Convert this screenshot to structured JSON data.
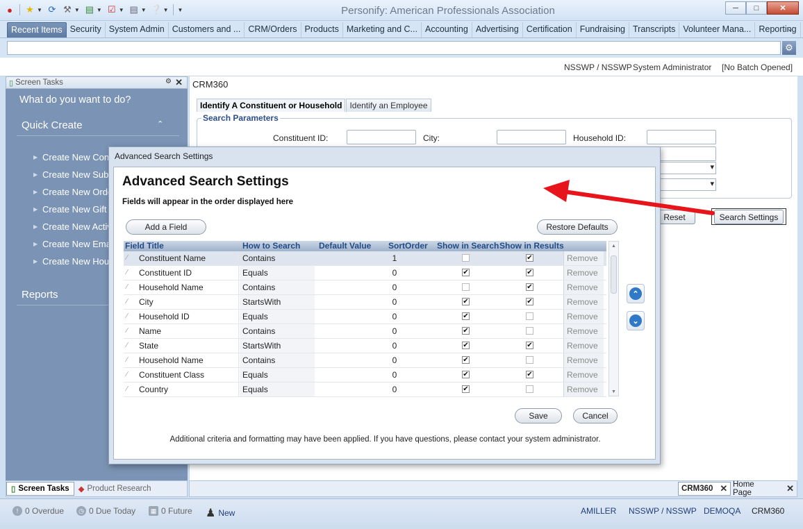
{
  "app": {
    "title": "Personify: American Professionals Association"
  },
  "ribbon": {
    "tabs": [
      "Recent Items",
      "Security",
      "System Admin",
      "Customers and ...",
      "CRM/Orders",
      "Products",
      "Marketing and C...",
      "Accounting",
      "Advertising",
      "Certification",
      "Fundraising",
      "Transcripts",
      "Volunteer Mana...",
      "Reporting"
    ]
  },
  "status": {
    "org": "NSSWP / NSSWP",
    "role": "System Administrator",
    "batch": "[No Batch Opened]"
  },
  "left_pane": {
    "header": "Screen Tasks",
    "question": "What do you want to do?",
    "quick_create": "Quick Create",
    "items": [
      "Create New Cons",
      "Create New Subs",
      "Create New Orde",
      "Create New Gift",
      "Create New Activ",
      "Create New Ema",
      "Create New Hous"
    ],
    "reports": "Reports",
    "bottom_tabs": [
      "Screen Tasks",
      "Product Research"
    ]
  },
  "main": {
    "title": "CRM360",
    "tabs": [
      "Identify A Constituent or Household",
      "Identify an Employee"
    ],
    "search_legend": "Search Parameters",
    "labels": {
      "constituent_id": "Constituent ID:",
      "city": "City:",
      "household_id": "Household ID:"
    },
    "reset": "Reset",
    "search_settings": "Search Settings"
  },
  "modal": {
    "caption": "Advanced Search Settings",
    "heading": "Advanced Search Settings",
    "subheading": "Fields will appear in the order displayed here",
    "add_field": "Add a Field",
    "restore": "Restore Defaults",
    "columns": [
      "Field Title",
      "How to Search",
      "Default Value",
      "SortOrder",
      "Show in Search",
      "Show in Results"
    ],
    "rows": [
      {
        "title": "Constituent Name",
        "how": "Contains",
        "sort": "1",
        "search": false,
        "results": true,
        "remove": "Remove"
      },
      {
        "title": "Constituent ID",
        "how": "Equals",
        "sort": "0",
        "search": true,
        "results": true,
        "remove": "Remove"
      },
      {
        "title": "Household Name",
        "how": "Contains",
        "sort": "0",
        "search": false,
        "results": true,
        "remove": "Remove"
      },
      {
        "title": "City",
        "how": "StartsWith",
        "sort": "0",
        "search": true,
        "results": true,
        "remove": "Remove"
      },
      {
        "title": "Household ID",
        "how": "Equals",
        "sort": "0",
        "search": true,
        "results": false,
        "remove": "Remove"
      },
      {
        "title": "Name",
        "how": "Contains",
        "sort": "0",
        "search": true,
        "results": false,
        "remove": "Remove"
      },
      {
        "title": "State",
        "how": "StartsWith",
        "sort": "0",
        "search": true,
        "results": true,
        "remove": "Remove"
      },
      {
        "title": "Household Name",
        "how": "Contains",
        "sort": "0",
        "search": true,
        "results": false,
        "remove": "Remove"
      },
      {
        "title": "Constituent Class",
        "how": "Equals",
        "sort": "0",
        "search": true,
        "results": true,
        "remove": "Remove"
      },
      {
        "title": "Country",
        "how": "Equals",
        "sort": "0",
        "search": true,
        "results": false,
        "remove": "Remove"
      }
    ],
    "save": "Save",
    "cancel": "Cancel",
    "footer_note": "Additional criteria and formatting may have been applied.  If you have questions, please contact your system administrator."
  },
  "doc_tabs": [
    "CRM360",
    "Home Page"
  ],
  "footer": {
    "overdue": "0 Overdue",
    "due_today": "0 Due Today",
    "future": "0 Future",
    "new": "New",
    "user": "AMILLER",
    "org": "NSSWP / NSSWP",
    "db": "DEMOQA",
    "module": "CRM360"
  },
  "colors": {
    "sidebar": "#7b93b4",
    "accent_blue": "#2f79c6",
    "annotation_arrow": "#e8141b"
  }
}
